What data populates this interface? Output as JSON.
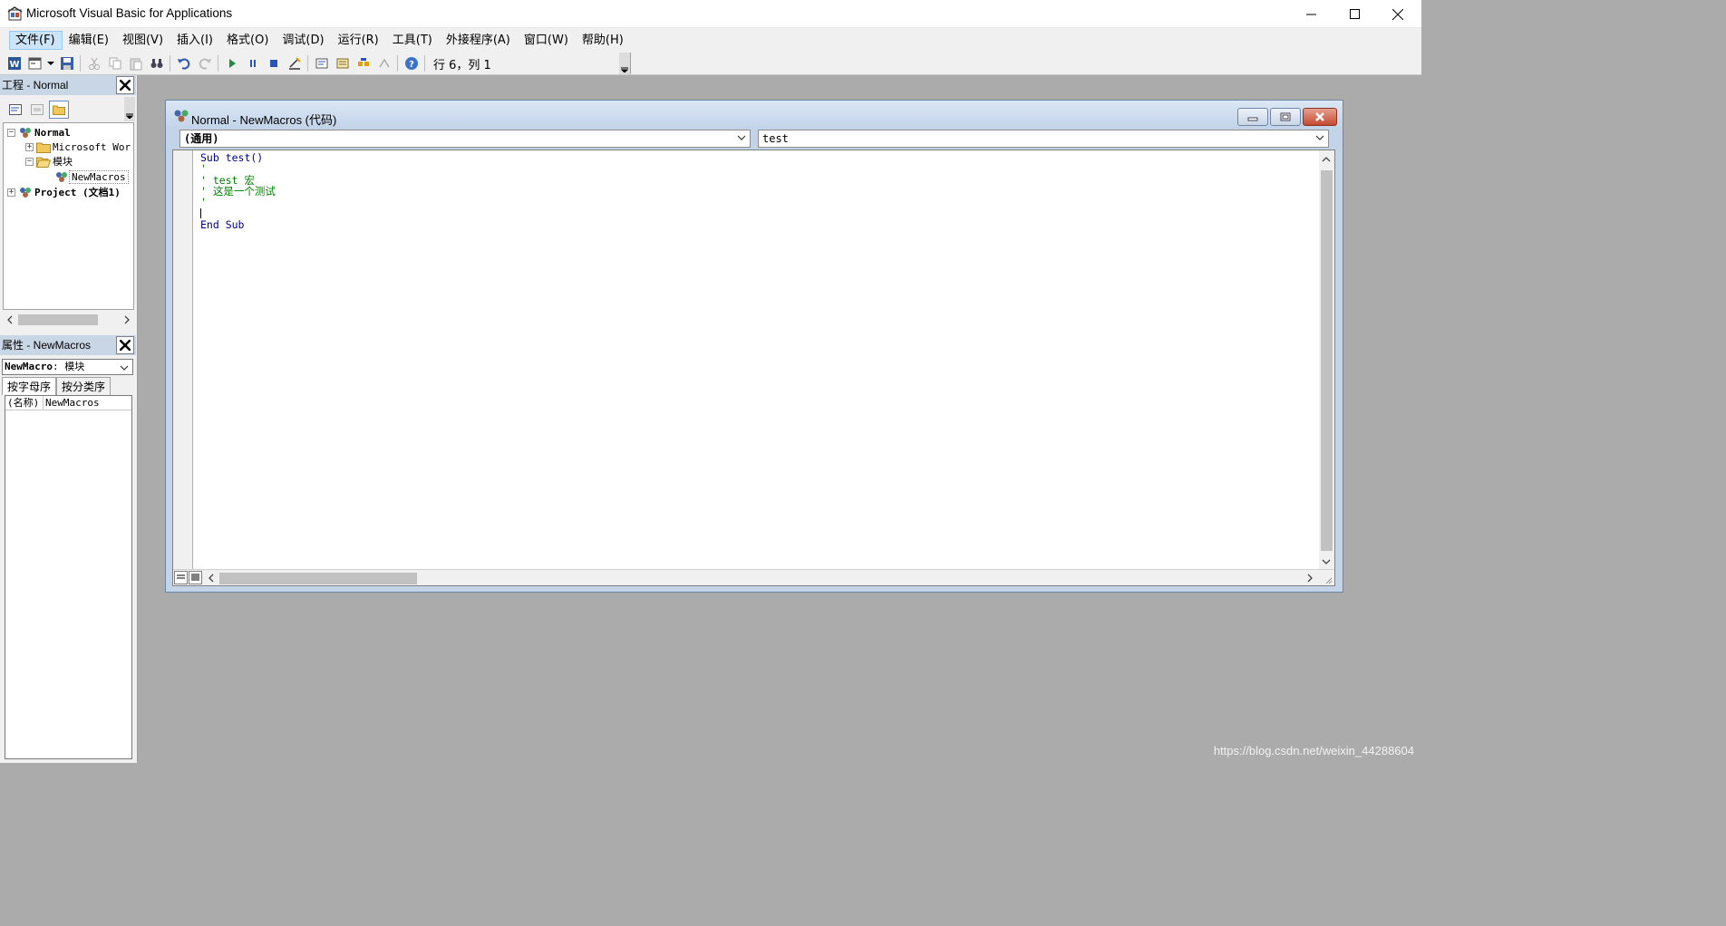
{
  "window": {
    "title": "Microsoft Visual Basic for Applications"
  },
  "menu": [
    {
      "label": "文件(F)"
    },
    {
      "label": "编辑(E)"
    },
    {
      "label": "视图(V)"
    },
    {
      "label": "插入(I)"
    },
    {
      "label": "格式(O)"
    },
    {
      "label": "调试(D)"
    },
    {
      "label": "运行(R)"
    },
    {
      "label": "工具(T)"
    },
    {
      "label": "外接程序(A)"
    },
    {
      "label": "窗口(W)"
    },
    {
      "label": "帮助(H)"
    }
  ],
  "toolbar": {
    "position_text": "行 6，列 1"
  },
  "project_pane": {
    "title": "工程 - Normal",
    "tree": {
      "normal": "Normal",
      "microsoft_word": "Microsoft Wor",
      "modules": "模块",
      "newmacros": "NewMacros",
      "project": "Project (文档1)"
    }
  },
  "properties_pane": {
    "title": "属性 - NewMacros",
    "object_name": "NewMacro",
    "object_type": "模块",
    "tabs": [
      "按字母序",
      "按分类序"
    ],
    "rows": [
      {
        "key": "(名称)",
        "value": "NewMacros"
      }
    ]
  },
  "code_window": {
    "title": "Normal - NewMacros (代码)",
    "object_combo": "(通用)",
    "procedure_combo": "test",
    "lines": {
      "l1": "Sub test()",
      "l2": "'",
      "l3": "' test 宏",
      "l4": "' 这是一个测试",
      "l5": "'",
      "l7": "End Sub"
    }
  },
  "watermark": "https://blog.csdn.net/weixin_44288604"
}
